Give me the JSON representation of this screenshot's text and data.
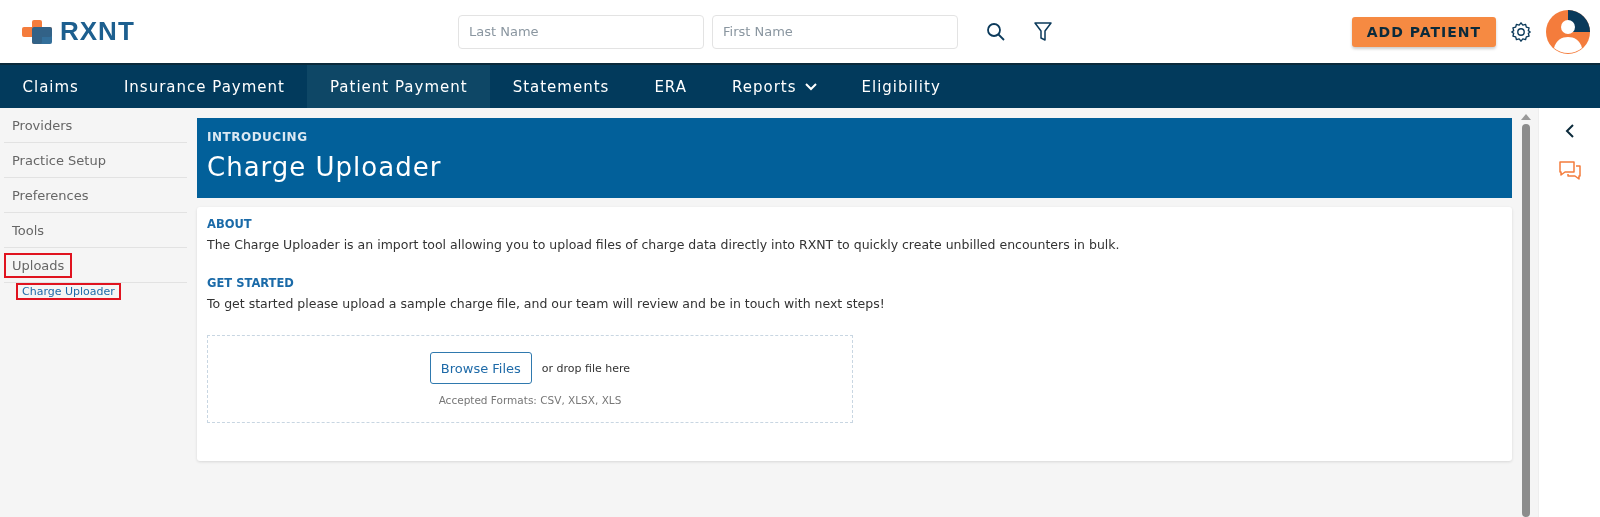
{
  "logo": {
    "text": "RXNT"
  },
  "search": {
    "fields": [
      {
        "placeholder": "Last Name"
      },
      {
        "placeholder": "First Name"
      }
    ]
  },
  "add_patient_button": "ADD PATIENT",
  "nav": [
    {
      "label": "Claims",
      "selected": false,
      "dropdown": false
    },
    {
      "label": "Insurance Payment",
      "selected": false,
      "dropdown": false
    },
    {
      "label": "Patient Payment",
      "selected": true,
      "dropdown": false
    },
    {
      "label": "Statements",
      "selected": false,
      "dropdown": false
    },
    {
      "label": "ERA",
      "selected": false,
      "dropdown": false
    },
    {
      "label": "Reports",
      "selected": false,
      "dropdown": true
    },
    {
      "label": "Eligibility",
      "selected": false,
      "dropdown": false
    }
  ],
  "sidebar": {
    "items": [
      {
        "label": "Providers",
        "selected": false,
        "highlighted": false
      },
      {
        "label": "Practice Setup",
        "selected": false,
        "highlighted": false
      },
      {
        "label": "Preferences",
        "selected": false,
        "highlighted": false
      },
      {
        "label": "Tools",
        "selected": false,
        "highlighted": false
      },
      {
        "label": "Uploads",
        "selected": false,
        "highlighted": true,
        "children": [
          {
            "label": "Charge Uploader",
            "selected": true,
            "highlighted": true
          }
        ]
      }
    ]
  },
  "banner": {
    "eyebrow": "INTRODUCING",
    "title": "Charge Uploader"
  },
  "sections": [
    {
      "heading": "ABOUT",
      "text": "The Charge Uploader is an import tool allowing you to upload files of charge data directly into RXNT to quickly create unbilled encounters in bulk."
    },
    {
      "heading": "GET STARTED",
      "text": "To get started please upload a sample charge file, and our team will review and be in touch with next steps!"
    }
  ],
  "dropzone": {
    "button": "Browse Files",
    "hint": "or drop file here",
    "formats": "Accepted Formats: CSV, XLSX, XLS"
  }
}
